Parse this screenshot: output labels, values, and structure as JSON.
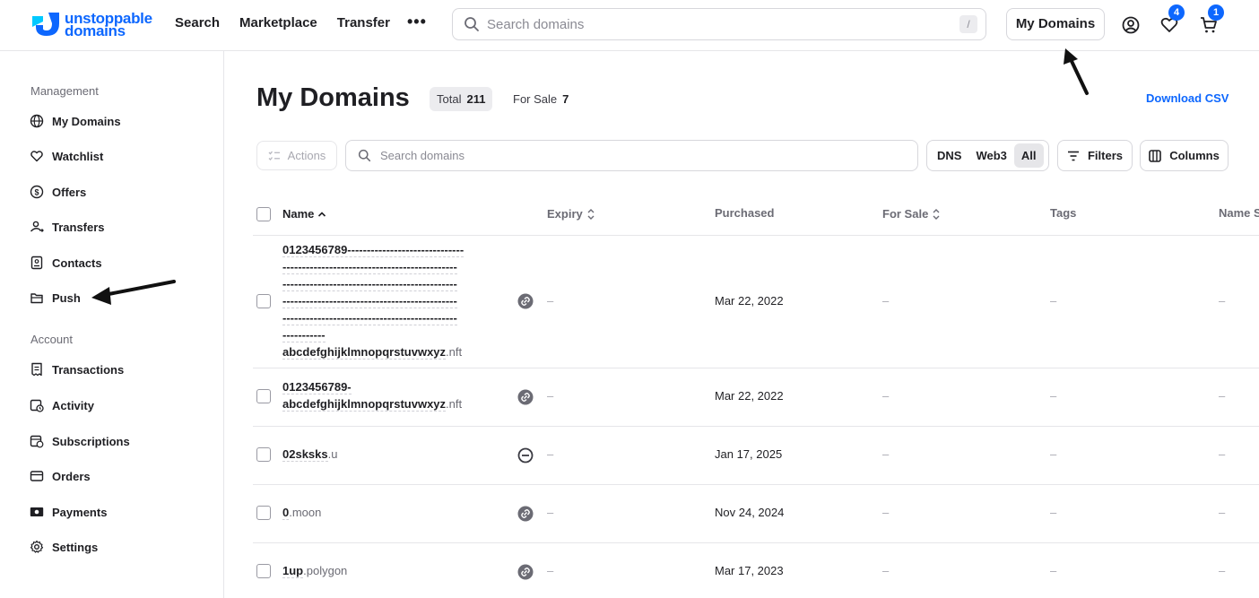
{
  "header": {
    "logo_line1": "unstoppable",
    "logo_line2": "domains",
    "nav": [
      "Search",
      "Marketplace",
      "Transfer"
    ],
    "more": "•••",
    "search_placeholder": "Search domains",
    "search_shortcut": "/",
    "my_domains_label": "My Domains",
    "watchlist_count": "4",
    "cart_count": "1"
  },
  "sidebar": {
    "section_management": "Management",
    "management": [
      "My Domains",
      "Watchlist",
      "Offers",
      "Transfers",
      "Contacts",
      "Push"
    ],
    "section_account": "Account",
    "account": [
      "Transactions",
      "Activity",
      "Subscriptions",
      "Orders",
      "Payments",
      "Settings"
    ]
  },
  "main": {
    "title": "My Domains",
    "total_label": "Total",
    "total_value": "211",
    "for_sale_label": "For Sale",
    "for_sale_value": "7",
    "download_label": "Download CSV",
    "actions_label": "Actions",
    "search_placeholder": "Search domains",
    "segments": [
      "DNS",
      "Web3",
      "All"
    ],
    "active_segment": "All",
    "filters_label": "Filters",
    "columns_label": "Columns"
  },
  "table": {
    "columns": [
      "Name",
      "Expiry",
      "Purchased",
      "For Sale",
      "Tags",
      "Name S"
    ],
    "rows": [
      {
        "name_lines": [
          "0123456789------------------------------",
          "---------------------------------------------",
          "---------------------------------------------",
          "---------------------------------------------",
          "---------------------------------------------",
          "-----------",
          "abcdefghijklmnopqrstuvwxyz"
        ],
        "ext": ".nft",
        "status": "link-icon",
        "expiry": "–",
        "purchased": "Mar 22, 2022",
        "for_sale": "–",
        "tags": "–",
        "name_s": "–"
      },
      {
        "name_lines": [
          "0123456789-",
          "abcdefghijklmnopqrstuvwxyz"
        ],
        "ext": ".nft",
        "status": "link-icon",
        "expiry": "–",
        "purchased": "Mar 22, 2022",
        "for_sale": "–",
        "tags": "–",
        "name_s": "–"
      },
      {
        "name_lines": [
          "02sksks"
        ],
        "ext": ".u",
        "status": "minus-circle-icon",
        "expiry": "–",
        "purchased": "Jan 17, 2025",
        "for_sale": "–",
        "tags": "–",
        "name_s": "–"
      },
      {
        "name_lines": [
          "0"
        ],
        "ext": ".moon",
        "status": "link-icon",
        "expiry": "–",
        "purchased": "Nov 24, 2024",
        "for_sale": "–",
        "tags": "–",
        "name_s": "–"
      },
      {
        "name_lines": [
          "1up"
        ],
        "ext": ".polygon",
        "status": "link-icon",
        "expiry": "–",
        "purchased": "Mar 17, 2023",
        "for_sale": "–",
        "tags": "–",
        "name_s": "–"
      }
    ]
  },
  "colors": {
    "brand": "#0d67fe",
    "border": "#e6e6e9",
    "muted": "#6b6b74"
  }
}
